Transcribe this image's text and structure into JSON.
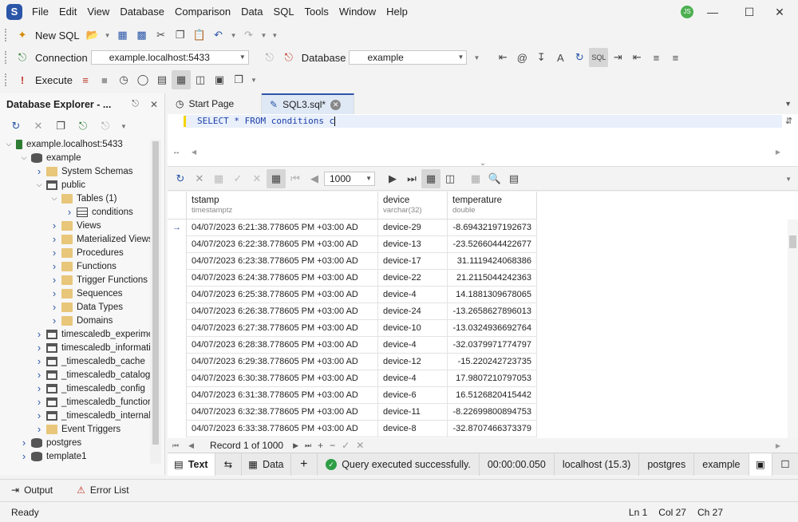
{
  "app": {
    "logo_letter": "S",
    "user_initials": "JS"
  },
  "menu": [
    "File",
    "Edit",
    "View",
    "Database",
    "Comparison",
    "Data",
    "SQL",
    "Tools",
    "Window",
    "Help"
  ],
  "toolbar": {
    "new_sql_label": "New SQL",
    "connection_label": "Connection",
    "connection_value": "example.localhost:5433",
    "database_label": "Database",
    "database_value": "example",
    "execute_label": "Execute"
  },
  "explorer": {
    "title": "Database Explorer - ...",
    "tree": [
      {
        "label": "example.localhost:5433",
        "level": 0,
        "expanded": true,
        "icon": "server-icon"
      },
      {
        "label": "example",
        "level": 1,
        "expanded": true,
        "icon": "database-icon"
      },
      {
        "label": "System Schemas",
        "level": 2,
        "expanded": false,
        "icon": "folder-icon"
      },
      {
        "label": "public",
        "level": 2,
        "expanded": true,
        "icon": "schema-icon"
      },
      {
        "label": "Tables (1)",
        "level": 3,
        "expanded": true,
        "icon": "folder-icon"
      },
      {
        "label": "conditions",
        "level": 4,
        "expanded": false,
        "icon": "table-icon"
      },
      {
        "label": "Views",
        "level": 3,
        "expanded": false,
        "icon": "folder-icon"
      },
      {
        "label": "Materialized Views",
        "level": 3,
        "expanded": false,
        "icon": "folder-icon"
      },
      {
        "label": "Procedures",
        "level": 3,
        "expanded": false,
        "icon": "folder-icon"
      },
      {
        "label": "Functions",
        "level": 3,
        "expanded": false,
        "icon": "folder-icon"
      },
      {
        "label": "Trigger Functions",
        "level": 3,
        "expanded": false,
        "icon": "folder-icon"
      },
      {
        "label": "Sequences",
        "level": 3,
        "expanded": false,
        "icon": "folder-icon"
      },
      {
        "label": "Data Types",
        "level": 3,
        "expanded": false,
        "icon": "folder-icon"
      },
      {
        "label": "Domains",
        "level": 3,
        "expanded": false,
        "icon": "folder-icon"
      },
      {
        "label": "timescaledb_experime",
        "level": 2,
        "expanded": false,
        "icon": "schema-icon"
      },
      {
        "label": "timescaledb_informati",
        "level": 2,
        "expanded": false,
        "icon": "schema-icon"
      },
      {
        "label": "_timescaledb_cache",
        "level": 2,
        "expanded": false,
        "icon": "schema-icon"
      },
      {
        "label": "_timescaledb_catalog",
        "level": 2,
        "expanded": false,
        "icon": "schema-icon"
      },
      {
        "label": "_timescaledb_config",
        "level": 2,
        "expanded": false,
        "icon": "schema-icon"
      },
      {
        "label": "_timescaledb_functior",
        "level": 2,
        "expanded": false,
        "icon": "schema-icon"
      },
      {
        "label": "_timescaledb_internal",
        "level": 2,
        "expanded": false,
        "icon": "schema-icon"
      },
      {
        "label": "Event Triggers",
        "level": 2,
        "expanded": false,
        "icon": "folder-icon"
      },
      {
        "label": "postgres",
        "level": 1,
        "expanded": false,
        "icon": "database-icon"
      },
      {
        "label": "template1",
        "level": 1,
        "expanded": false,
        "icon": "database-icon"
      }
    ]
  },
  "tabs": [
    {
      "label": "Start Page",
      "active": false
    },
    {
      "label": "SQL3.sql*",
      "active": true
    }
  ],
  "editor": {
    "sql": "SELECT * FROM conditions c"
  },
  "grid_toolbar": {
    "page_size": "1000"
  },
  "grid": {
    "columns": [
      {
        "name": "tstamp",
        "type": "timestamptz"
      },
      {
        "name": "device",
        "type": "varchar(32)"
      },
      {
        "name": "temperature",
        "type": "double"
      }
    ],
    "rows": [
      [
        "04/07/2023 6:21:38.778605 PM +03:00 AD",
        "device-29",
        "-8.69432197192673"
      ],
      [
        "04/07/2023 6:22:38.778605 PM +03:00 AD",
        "device-13",
        "-23.5266044422677"
      ],
      [
        "04/07/2023 6:23:38.778605 PM +03:00 AD",
        "device-17",
        "31.1119424068386"
      ],
      [
        "04/07/2023 6:24:38.778605 PM +03:00 AD",
        "device-22",
        "21.2115044242363"
      ],
      [
        "04/07/2023 6:25:38.778605 PM +03:00 AD",
        "device-4",
        "14.1881309678065"
      ],
      [
        "04/07/2023 6:26:38.778605 PM +03:00 AD",
        "device-24",
        "-13.2658627896013"
      ],
      [
        "04/07/2023 6:27:38.778605 PM +03:00 AD",
        "device-10",
        "-13.0324936692764"
      ],
      [
        "04/07/2023 6:28:38.778605 PM +03:00 AD",
        "device-4",
        "-32.0379971774797"
      ],
      [
        "04/07/2023 6:29:38.778605 PM +03:00 AD",
        "device-12",
        "-15.220242723735"
      ],
      [
        "04/07/2023 6:30:38.778605 PM +03:00 AD",
        "device-4",
        "17.9807210797053"
      ],
      [
        "04/07/2023 6:31:38.778605 PM +03:00 AD",
        "device-6",
        "16.5126820415442"
      ],
      [
        "04/07/2023 6:32:38.778605 PM +03:00 AD",
        "device-11",
        "-8.22699800894753"
      ],
      [
        "04/07/2023 6:33:38.778605 PM +03:00 AD",
        "device-8",
        "-32.8707466373379"
      ]
    ]
  },
  "record_nav": {
    "label": "Record 1 of 1000"
  },
  "bottom_tabs": {
    "text_label": "Text",
    "data_label": "Data"
  },
  "result_status": {
    "message": "Query executed successfully.",
    "elapsed": "00:00:00.050",
    "server": "localhost (15.3)",
    "user": "postgres",
    "database": "example"
  },
  "output_tabs": {
    "output_label": "Output",
    "error_list_label": "Error List"
  },
  "statusbar": {
    "state": "Ready",
    "ln": "Ln 1",
    "col": "Col 27",
    "ch": "Ch 27"
  },
  "colors": {
    "accent": "#2b56a8",
    "success": "#2e9e45",
    "keyword": "#1c3ea8"
  }
}
